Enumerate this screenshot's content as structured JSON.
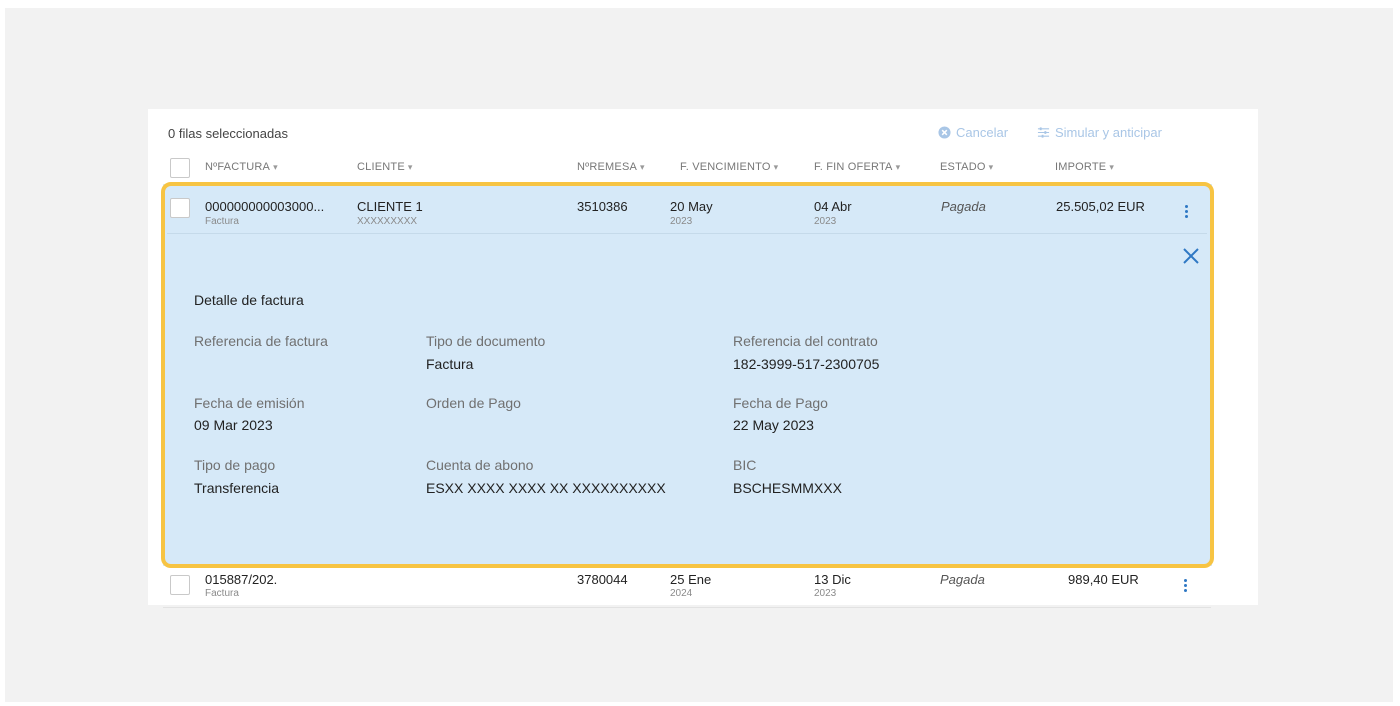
{
  "toolbar": {
    "selection_text": "0 filas seleccionadas",
    "cancel_label": "Cancelar",
    "simulate_label": "Simular y anticipar"
  },
  "columns": {
    "invoice": "NºFACTURA",
    "client": "CLIENTE",
    "remittance": "NºREMESA",
    "due_date": "F. VENCIMIENTO",
    "offer_end": "F. FIN OFERTA",
    "status": "ESTADO",
    "amount": "IMPORTE"
  },
  "rows": [
    {
      "invoice": "000000000003000...",
      "invoice_type": "Factura",
      "client": "CLIENTE 1",
      "client_id": "XXXXXXXXX",
      "remittance": "3510386",
      "due_day": "20 May",
      "due_year": "2023",
      "offer_day": "04 Abr",
      "offer_year": "2023",
      "status": "Pagada",
      "amount": "25.505,02 EUR"
    },
    {
      "invoice": "015887/202.",
      "invoice_type": "Factura",
      "client": "",
      "client_id": "",
      "remittance": "3780044",
      "due_day": "25 Ene",
      "due_year": "2024",
      "offer_day": "13 Dic",
      "offer_year": "2023",
      "status": "Pagada",
      "amount": "989,40 EUR"
    }
  ],
  "detail": {
    "title": "Detalle de factura",
    "fields": {
      "invoice_ref_label": "Referencia de factura",
      "invoice_ref_value": "",
      "doc_type_label": "Tipo de documento",
      "doc_type_value": "Factura",
      "contract_ref_label": "Referencia del contrato",
      "contract_ref_value": "182-3999-517-2300705",
      "issue_date_label": "Fecha de emisión",
      "issue_date_value": "09 Mar 2023",
      "payment_order_label": "Orden de Pago",
      "payment_order_value": "",
      "payment_date_label": "Fecha de Pago",
      "payment_date_value": "22 May 2023",
      "payment_type_label": "Tipo de pago",
      "payment_type_value": "Transferencia",
      "account_label": "Cuenta de abono",
      "account_value": "ESXX XXXX XXXX XX XXXXXXXXXX",
      "bic_label": "BIC",
      "bic_value": "BSCHESMMXXX"
    }
  },
  "colors": {
    "accent": "#2f78c4",
    "highlight": "#f7c443",
    "detail_bg": "#d6e9f8"
  }
}
